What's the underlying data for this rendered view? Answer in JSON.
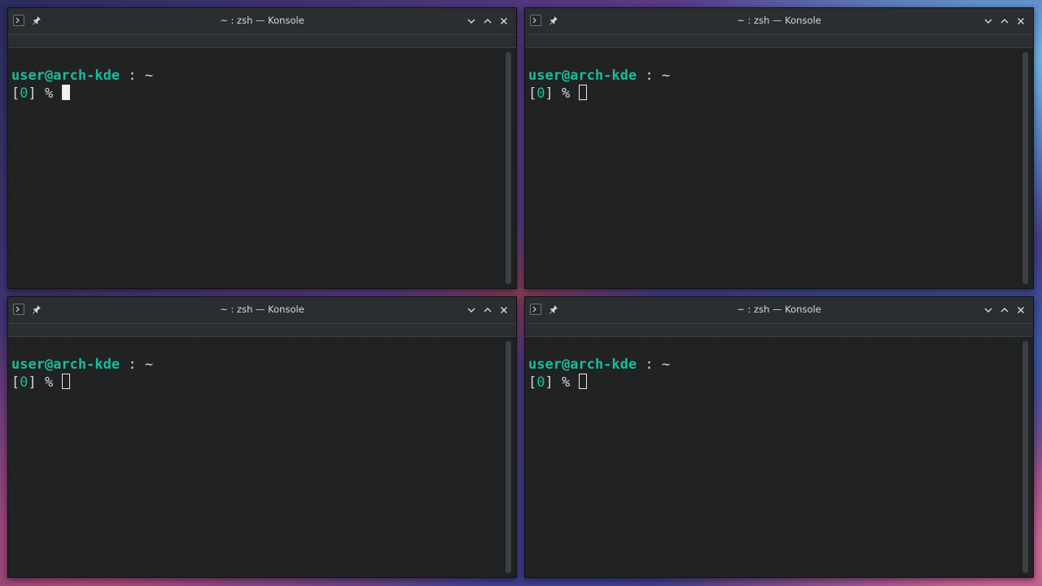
{
  "windows": [
    {
      "title": "~ : zsh — Konsole",
      "user_host": "user@arch-kde",
      "separator": ":",
      "path": "~",
      "open_bracket": "[",
      "exit_code": "0",
      "close_bracket": "]",
      "prompt_symbol": "%",
      "active": true
    },
    {
      "title": "~ : zsh — Konsole",
      "user_host": "user@arch-kde",
      "separator": ":",
      "path": "~",
      "open_bracket": "[",
      "exit_code": "0",
      "close_bracket": "]",
      "prompt_symbol": "%",
      "active": false
    },
    {
      "title": "~ : zsh — Konsole",
      "user_host": "user@arch-kde",
      "separator": ":",
      "path": "~",
      "open_bracket": "[",
      "exit_code": "0",
      "close_bracket": "]",
      "prompt_symbol": "%",
      "active": false
    },
    {
      "title": "~ : zsh — Konsole",
      "user_host": "user@arch-kde",
      "separator": ":",
      "path": "~",
      "open_bracket": "[",
      "exit_code": "0",
      "close_bracket": "]",
      "prompt_symbol": "%",
      "active": false
    }
  ],
  "icons": {
    "app": "konsole-app-icon",
    "pin": "pin-icon",
    "minimize": "minimize-icon",
    "maximize": "maximize-icon",
    "close": "close-icon"
  },
  "colors": {
    "prompt_accent": "#1abc9c",
    "terminal_bg": "#1f2122",
    "titlebar_bg": "#2b2e31"
  }
}
